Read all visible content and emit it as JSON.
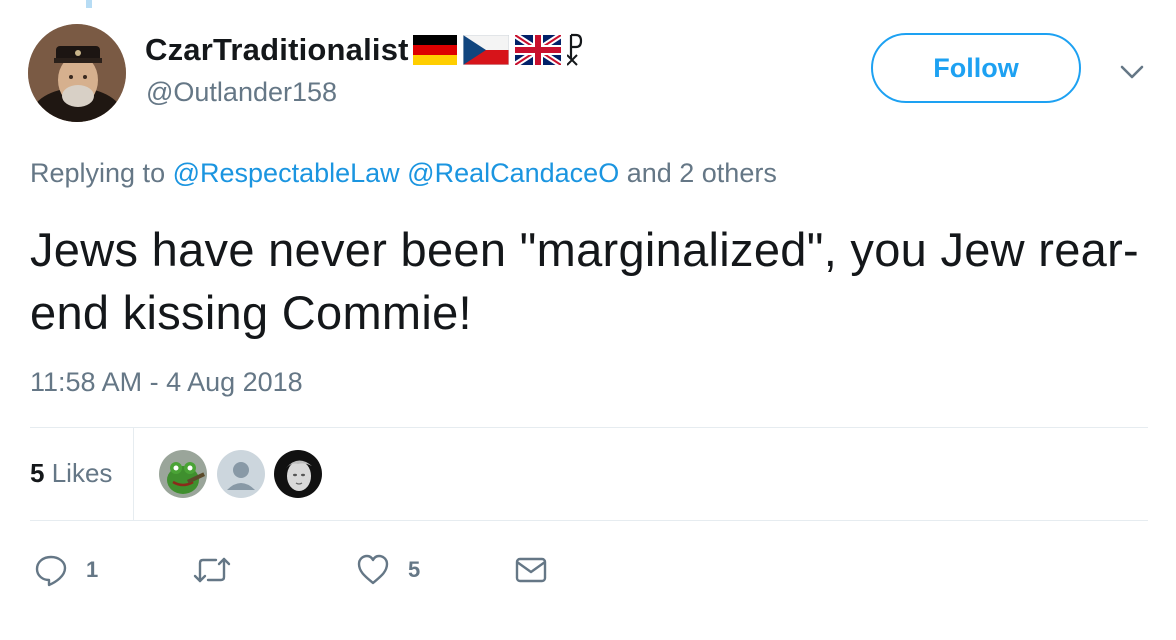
{
  "user": {
    "display_name": "CzarTraditionalist",
    "handle": "@Outlander158",
    "name_flags": [
      "germany-flag",
      "czech-flag",
      "uk-flag",
      "chi-rho-symbol"
    ]
  },
  "follow_button": {
    "label": "Follow"
  },
  "reply_context": {
    "prefix": "Replying to",
    "mentions": [
      "@RespectableLaw",
      "@RealCandaceO"
    ],
    "suffix": "and 2 others"
  },
  "tweet": {
    "text": "Jews have never been \"marginalized\", you Jew rear-end kissing Commie!",
    "timestamp": "11:58 AM - 4 Aug 2018"
  },
  "likes_summary": {
    "count": "5",
    "label": "Likes",
    "avatars": [
      "frog-avatar",
      "default-avatar",
      "statue-avatar"
    ]
  },
  "actions": {
    "reply": {
      "icon": "reply-icon",
      "count": "1"
    },
    "retweet": {
      "icon": "retweet-icon",
      "count": ""
    },
    "like": {
      "icon": "heart-icon",
      "count": "5"
    },
    "message": {
      "icon": "mail-icon"
    }
  },
  "colors": {
    "accent": "#1da1f2",
    "link": "#1b95e0",
    "secondary_text": "#657786",
    "primary_text": "#14171a",
    "divider": "#e6ecf0"
  }
}
